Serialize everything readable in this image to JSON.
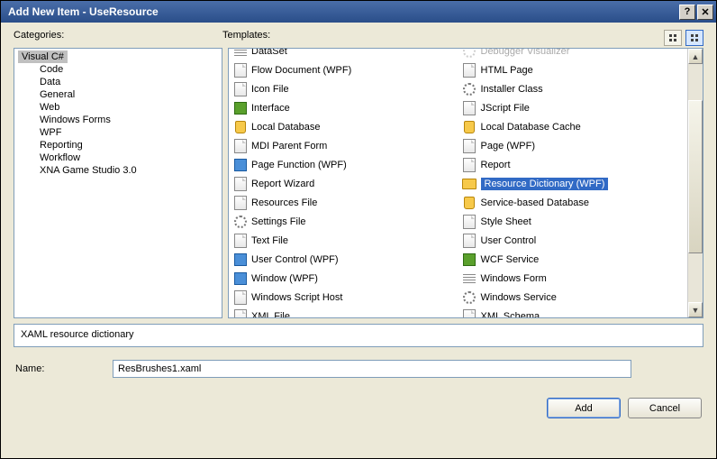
{
  "window": {
    "title": "Add New Item - UseResource"
  },
  "labels": {
    "categories": "Categories:",
    "templates": "Templates:",
    "name": "Name:"
  },
  "categories": {
    "root": "Visual C#",
    "children": [
      "Code",
      "Data",
      "General",
      "Web",
      "Windows Forms",
      "WPF",
      "Reporting",
      "Workflow",
      "XNA Game Studio 3.0"
    ]
  },
  "templates": {
    "col1": [
      {
        "label": "DataSet",
        "icon": "grid"
      },
      {
        "label": "Flow Document (WPF)",
        "icon": "page"
      },
      {
        "label": "Icon File",
        "icon": "page"
      },
      {
        "label": "Interface",
        "icon": "green"
      },
      {
        "label": "Local Database",
        "icon": "db"
      },
      {
        "label": "MDI Parent Form",
        "icon": "page"
      },
      {
        "label": "Page Function (WPF)",
        "icon": "blue"
      },
      {
        "label": "Report Wizard",
        "icon": "page"
      },
      {
        "label": "Resources File",
        "icon": "page"
      },
      {
        "label": "Settings File",
        "icon": "gear"
      },
      {
        "label": "Text File",
        "icon": "page"
      },
      {
        "label": "User Control (WPF)",
        "icon": "blue"
      },
      {
        "label": "Window (WPF)",
        "icon": "blue"
      },
      {
        "label": "Windows Script Host",
        "icon": "page"
      },
      {
        "label": "XML File",
        "icon": "page"
      }
    ],
    "col2": [
      {
        "label": "Debugger Visualizer",
        "icon": "gear",
        "cut": true
      },
      {
        "label": "HTML Page",
        "icon": "page"
      },
      {
        "label": "Installer Class",
        "icon": "gear"
      },
      {
        "label": "JScript File",
        "icon": "page"
      },
      {
        "label": "Local Database Cache",
        "icon": "db"
      },
      {
        "label": "Page (WPF)",
        "icon": "page"
      },
      {
        "label": "Report",
        "icon": "page"
      },
      {
        "label": "Resource Dictionary (WPF)",
        "icon": "folder",
        "selected": true
      },
      {
        "label": "Service-based Database",
        "icon": "db"
      },
      {
        "label": "Style Sheet",
        "icon": "page"
      },
      {
        "label": "User Control",
        "icon": "page"
      },
      {
        "label": "WCF Service",
        "icon": "green"
      },
      {
        "label": "Windows Form",
        "icon": "grid"
      },
      {
        "label": "Windows Service",
        "icon": "gear"
      },
      {
        "label": "XML Schema",
        "icon": "page"
      }
    ]
  },
  "description": "XAML resource dictionary",
  "name_value": "ResBrushes1.xaml",
  "buttons": {
    "add": "Add",
    "cancel": "Cancel",
    "help": "?",
    "close": "✕"
  }
}
